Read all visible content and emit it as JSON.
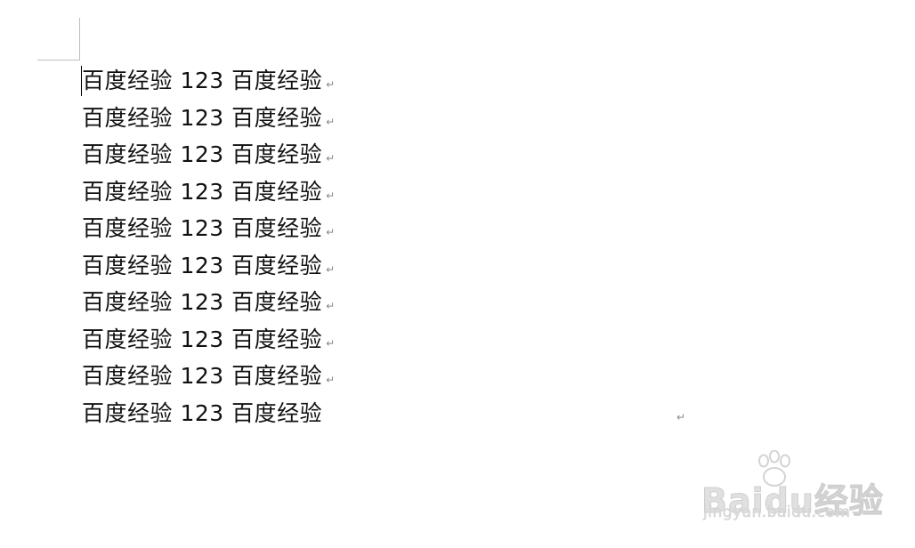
{
  "document": {
    "paragraphs": [
      {
        "text": "百度经验 123 百度经验",
        "mark": "↵"
      },
      {
        "text": "百度经验 123 百度经验",
        "mark": "↵"
      },
      {
        "text": "百度经验 123 百度经验",
        "mark": "↵"
      },
      {
        "text": "百度经验 123 百度经验",
        "mark": "↵"
      },
      {
        "text": "百度经验 123 百度经验",
        "mark": "↵"
      },
      {
        "text": "百度经验 123 百度经验",
        "mark": "↵"
      },
      {
        "text": "百度经验 123 百度经验",
        "mark": "↵"
      },
      {
        "text": "百度经验 123 百度经验",
        "mark": "↵"
      },
      {
        "text": "百度经验 123 百度经验",
        "mark": "↵"
      },
      {
        "text": "百度经验 123 百度经验",
        "mark": "↵"
      }
    ]
  },
  "watermark": {
    "logo": "Baidu经验",
    "url": "jingyan.baidu.com"
  }
}
